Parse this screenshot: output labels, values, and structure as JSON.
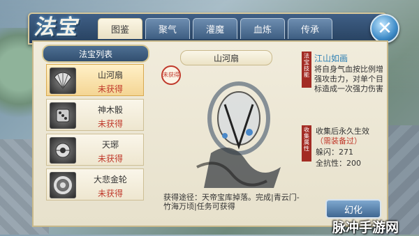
{
  "header": {
    "logo_text": "法宝",
    "tabs": [
      {
        "label": "图鉴",
        "active": true
      },
      {
        "label": "聚气",
        "active": false
      },
      {
        "label": "灌魔",
        "active": false
      },
      {
        "label": "血炼",
        "active": false
      },
      {
        "label": "传承",
        "active": false
      }
    ],
    "close_symbol": "✕"
  },
  "list": {
    "title": "法宝列表",
    "items": [
      {
        "name": "山河扇",
        "status": "未获得",
        "icon": "fan-icon",
        "active": true
      },
      {
        "name": "神木骰",
        "status": "未获得",
        "icon": "dice-icon",
        "active": false
      },
      {
        "name": "天琊",
        "status": "未获得",
        "icon": "tianya-icon",
        "active": false
      },
      {
        "name": "大悲金轮",
        "status": "未获得",
        "icon": "golden-wheel-icon",
        "active": false
      }
    ]
  },
  "detail": {
    "title": "山河扇",
    "seal_text": "未获得",
    "source_text": "获得途径：天帝宝库掉落。完成|青云门-竹海万顷|任务可获得",
    "skill_label": "法宝技能",
    "skill_name": "江山如画",
    "skill_desc": "将自身气血按比例增强攻击力，对单个目标造成一次强力伤害",
    "collect_label": "收集属性",
    "collect_title": "收集后永久生效",
    "collect_note": "（需装备过）",
    "stats": [
      {
        "label": "躲闪：",
        "value": "271"
      },
      {
        "label": "全抗性：",
        "value": "200"
      }
    ],
    "refine_button": "幻化"
  },
  "watermark": "脉冲手游网",
  "colors": {
    "accent_red": "#c0392b",
    "header_blue": "#2f4e73",
    "panel_beige": "#efe9d7",
    "skill_blue": "#2d7fb3"
  }
}
